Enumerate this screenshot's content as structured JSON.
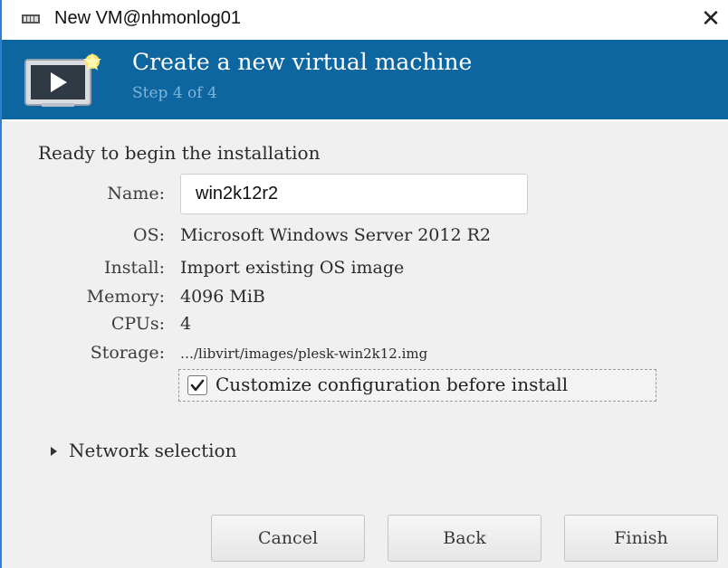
{
  "window": {
    "title": "New VM@nhmonlog01",
    "close_glyph": "✕",
    "close_icon": "close-icon",
    "app_icon": "virt-manager-icon"
  },
  "banner": {
    "icon": "new-vm-monitor-icon",
    "heading": "Create a new virtual machine",
    "step": "Step 4 of 4",
    "background_color": "#0e66a0"
  },
  "summary": {
    "section_title": "Ready to begin the installation",
    "name": {
      "label": "Name:",
      "value": "win2k12r2"
    },
    "os": {
      "label": "OS:",
      "value": "Microsoft Windows Server 2012 R2"
    },
    "install": {
      "label": "Install:",
      "value": "Import existing OS image"
    },
    "memory": {
      "label": "Memory:",
      "value": "4096 MiB"
    },
    "cpus": {
      "label": "CPUs:",
      "value": "4"
    },
    "storage": {
      "label": "Storage:",
      "value": "…/libvirt/images/plesk-win2k12.img"
    }
  },
  "customize": {
    "label": "Customize configuration before install",
    "checked": true
  },
  "network": {
    "label": "Network selection",
    "expanded": false
  },
  "buttons": {
    "cancel": "Cancel",
    "back": "Back",
    "finish": "Finish"
  }
}
